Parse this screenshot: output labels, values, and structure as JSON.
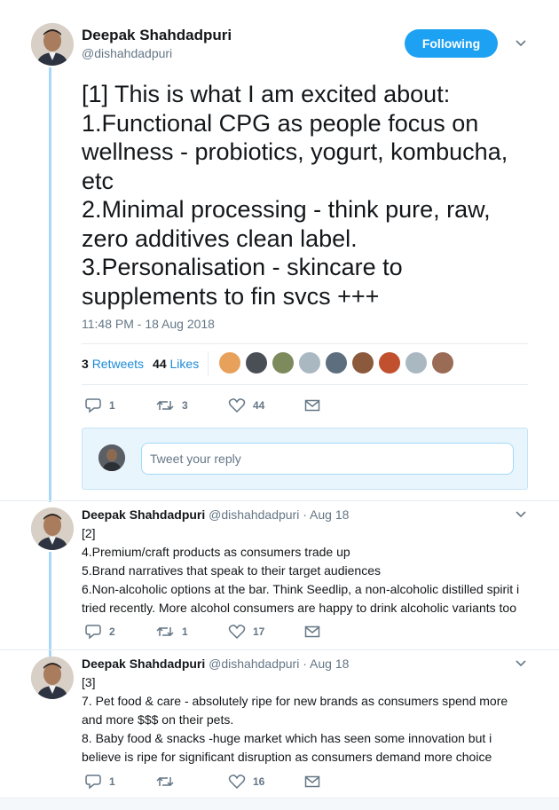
{
  "main_tweet": {
    "name": "Deepak Shahdadpuri",
    "handle": "@dishahdadpuri",
    "follow_label": "Following",
    "text_lines": [
      "[1] This is what I am excited about:",
      "1.Functional CPG as people focus on",
      "wellness - probiotics, yogurt, kombucha,",
      "etc",
      "2.Minimal processing - think pure, raw,",
      "zero additives clean label.",
      "3.Personalisation - skincare to",
      "supplements to fin svcs +++"
    ],
    "timestamp": "11:48 PM - 18 Aug 2018",
    "retweets_count": "3",
    "retweets_label": "Retweets",
    "likes_count": "44",
    "likes_label": "Likes",
    "actions": {
      "replies": "1",
      "retweets": "3",
      "likes": "44"
    },
    "liker_avatar_colors": [
      "#e8a15a",
      "#4a4f56",
      "#7c8a5c",
      "#aab8c2",
      "#5d6e7e",
      "#8b5a3c",
      "#c0502e",
      "#aab8c2",
      "#9a6b55"
    ]
  },
  "reply_box": {
    "placeholder": "Tweet your reply"
  },
  "replies": [
    {
      "name": "Deepak Shahdadpuri",
      "handle": "@dishahdadpuri",
      "dot": "·",
      "date": "Aug 18",
      "lines": [
        "[2]",
        "4.Premium/craft products as consumers trade up",
        "5.Brand narratives that speak to their target audiences",
        "6.Non-alcoholic options at the bar. Think Seedlip, a non-alcoholic distilled spirit i",
        "tried recently. More alcohol consumers are happy to drink alcoholic variants too"
      ],
      "actions": {
        "replies": "2",
        "retweets": "1",
        "likes": "17"
      }
    },
    {
      "name": "Deepak Shahdadpuri",
      "handle": "@dishahdadpuri",
      "dot": "·",
      "date": "Aug 18",
      "lines": [
        "[3]",
        "7. Pet food & care - absolutely ripe for new brands as consumers spend more",
        "and more $$$ on their pets.",
        "8. Baby food & snacks -huge market which has seen some innovation but i",
        "believe is ripe for significant disruption as consumers demand more choice"
      ],
      "actions": {
        "replies": "1",
        "retweets": "",
        "likes": "16"
      }
    }
  ],
  "colors": {
    "accent": "#1da1f2",
    "thread_line": "#a9d7f7",
    "muted": "#657786"
  }
}
